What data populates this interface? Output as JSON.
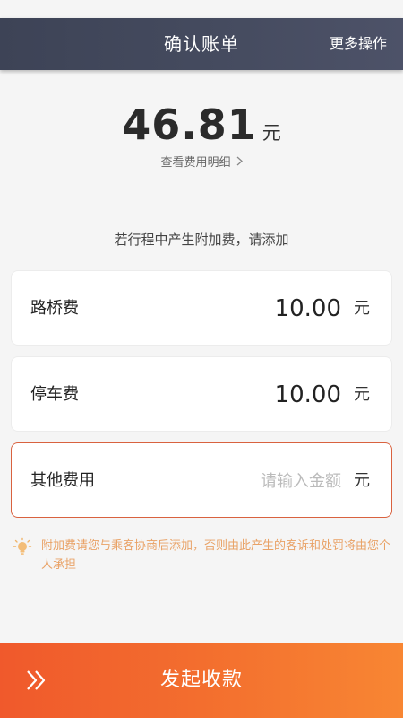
{
  "header": {
    "title": "确认账单",
    "more_label": "更多操作"
  },
  "summary": {
    "amount": "46.81",
    "unit": "元",
    "detail_link": "查看费用明细"
  },
  "hint": "若行程中产生附加费，请添加",
  "fees": [
    {
      "label": "路桥费",
      "value": "10.00",
      "unit": "元"
    },
    {
      "label": "停车费",
      "value": "10.00",
      "unit": "元"
    },
    {
      "label": "其他费用",
      "placeholder": "请输入金额",
      "value": "",
      "unit": "元"
    }
  ],
  "notice": {
    "icon": "lightbulb-icon",
    "text": "附加费请您与乘客协商后添加，否则由此产生的客诉和处罚将由您个人承担"
  },
  "footer": {
    "button_label": "发起收款",
    "icon": "double-chevron-right-icon"
  },
  "colors": {
    "header_bg": "#454b5f",
    "accent": "#f36e2e",
    "active_border": "#d9623f",
    "notice_text": "#e9a266"
  }
}
